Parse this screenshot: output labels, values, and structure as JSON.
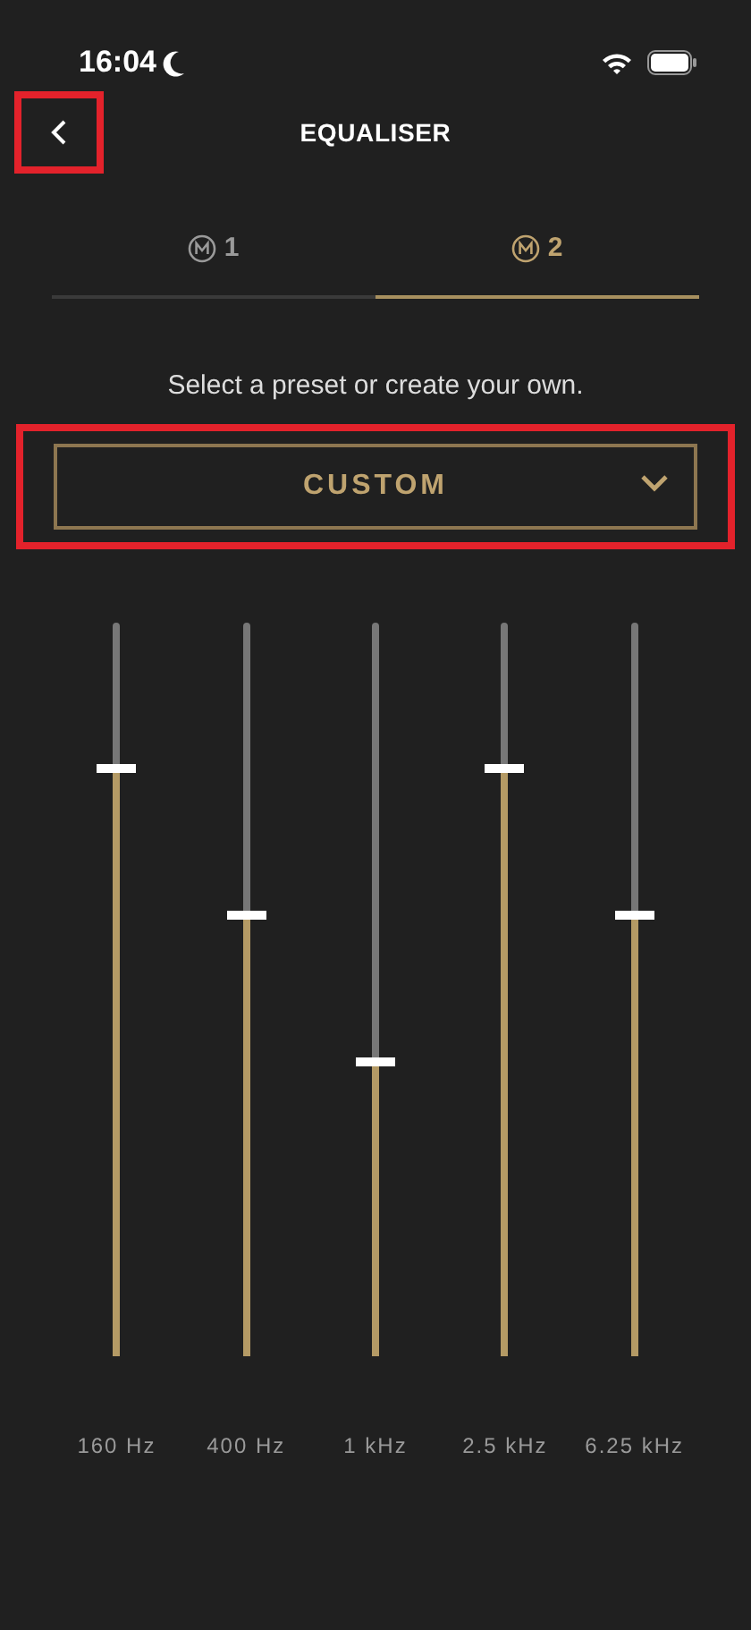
{
  "status_bar": {
    "time": "16:04"
  },
  "header": {
    "title": "EQUALISER",
    "back_button": {
      "highlighted": true
    }
  },
  "tabs": [
    {
      "label": "1",
      "selected": false
    },
    {
      "label": "2",
      "selected": true
    }
  ],
  "description": "Select a preset or create your own.",
  "preset_dropdown": {
    "value": "CUSTOM",
    "highlighted": true
  },
  "bands": [
    {
      "label": "160 Hz",
      "level": 0.8
    },
    {
      "label": "400 Hz",
      "level": 0.6
    },
    {
      "label": "1 kHz",
      "level": 0.4
    },
    {
      "label": "2.5 kHz",
      "level": 0.8
    },
    {
      "label": "6.25 kHz",
      "level": 0.6
    }
  ]
}
